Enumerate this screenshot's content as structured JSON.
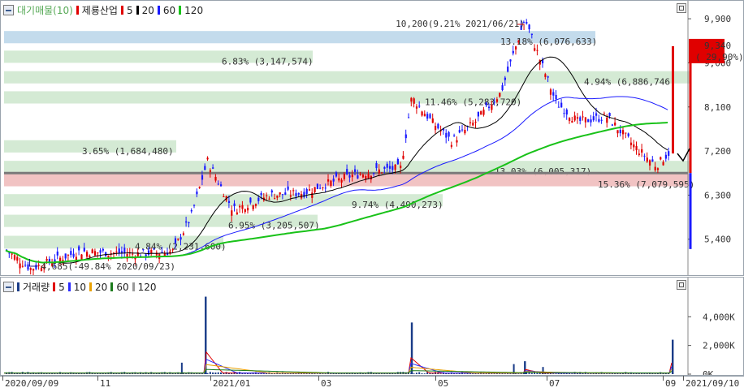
{
  "price_legend": {
    "title": "대기매물(10)",
    "stock_name": "제룡산업",
    "ma_labels": [
      "5",
      "20",
      "60",
      "120"
    ],
    "colors": {
      "stock": "#e00000",
      "ma5": "#e00000",
      "ma20": "#000000",
      "ma60": "#1a1aff",
      "ma120": "#19c219"
    }
  },
  "volume_legend": {
    "title": "거래량",
    "ma_labels": [
      "5",
      "10",
      "20",
      "60",
      "120"
    ],
    "colors": {
      "volume": "#1a3c88",
      "ma5": "#e00000",
      "ma10": "#2b2bff",
      "ma20": "#e8a000",
      "ma60": "#1a7a1a",
      "ma120": "#999999"
    }
  },
  "price_axis": [
    "9,900",
    "9,000",
    "8,100",
    "7,200",
    "6,300",
    "5,400"
  ],
  "current_price": {
    "value": "9,340",
    "change": "( 29,90%)"
  },
  "volume_axis": [
    "4,000K",
    "2,000K",
    "0K"
  ],
  "date_axis": [
    "2020/09/09",
    "11",
    "2021/01",
    "03",
    "05",
    "07",
    "09",
    "2021/09/10"
  ],
  "annotations": {
    "high": "10,200(9.21% 2021/06/21)",
    "low": "4,685(-49.84% 2020/09/23)"
  },
  "supply_bands": [
    {
      "label": "13.18% (6,076,633)",
      "color": "#bcd7ea"
    },
    {
      "label": "6.83% (3,147,574)",
      "color": "#cfe8cf"
    },
    {
      "label": "4.94% (6,886,746)",
      "color": "#cfe8cf"
    },
    {
      "label": "11.46% (5,283,720)",
      "color": "#cfe8cf"
    },
    {
      "label": "3.65% (1,684,480)",
      "color": "#cfe8cf"
    },
    {
      "label": "13.03% (6,005,317)",
      "color": "#cfe8cf"
    },
    {
      "label": "15.36% (7,079,595)",
      "color": "#efbcbc"
    },
    {
      "label": "9.74% (4,490,273)",
      "color": "#cfe8cf"
    },
    {
      "label": "6.95% (3,205,507)",
      "color": "#cfe8cf"
    },
    {
      "label": "4.84% (2,231,600)",
      "color": "#cfe8cf"
    }
  ],
  "chart_data": {
    "type": "candlestick",
    "title": "제룡산업",
    "x_range": [
      "2020/09/09",
      "2021/09/10"
    ],
    "ylim": [
      4700,
      10200
    ],
    "y_ticks": [
      9900,
      9000,
      8100,
      7200,
      6300,
      5400
    ],
    "last_price": 9340,
    "last_change_pct": 29.9,
    "period_high": {
      "value": 10200,
      "pct": 9.21,
      "date": "2021/06/21"
    },
    "period_low": {
      "value": 4685,
      "pct": -49.84,
      "date": "2020/09/23"
    },
    "close_anchors": [
      {
        "date": "2020/09/09",
        "close": 5200
      },
      {
        "date": "2020/09/23",
        "close": 4800
      },
      {
        "date": "2020/10/20",
        "close": 5150
      },
      {
        "date": "2020/11/20",
        "close": 5100
      },
      {
        "date": "2020/12/10",
        "close": 5150
      },
      {
        "date": "2020/12/20",
        "close": 5850
      },
      {
        "date": "2020/12/29",
        "close": 7000
      },
      {
        "date": "2021/01/12",
        "close": 6000
      },
      {
        "date": "2021/02/01",
        "close": 6300
      },
      {
        "date": "2021/02/20",
        "close": 6350
      },
      {
        "date": "2021/03/02",
        "close": 6500
      },
      {
        "date": "2021/03/18",
        "close": 6700
      },
      {
        "date": "2021/04/02",
        "close": 6800
      },
      {
        "date": "2021/04/14",
        "close": 6850
      },
      {
        "date": "2021/04/20",
        "close": 8300
      },
      {
        "date": "2021/05/01",
        "close": 7800
      },
      {
        "date": "2021/05/12",
        "close": 7400
      },
      {
        "date": "2021/05/25",
        "close": 7800
      },
      {
        "date": "2021/06/08",
        "close": 8400
      },
      {
        "date": "2021/06/21",
        "close": 9900
      },
      {
        "date": "2021/06/30",
        "close": 9000
      },
      {
        "date": "2021/07/08",
        "close": 8200
      },
      {
        "date": "2021/07/20",
        "close": 7800
      },
      {
        "date": "2021/08/05",
        "close": 7900
      },
      {
        "date": "2021/08/20",
        "close": 7300
      },
      {
        "date": "2021/09/01",
        "close": 6900
      },
      {
        "date": "2021/09/09",
        "close": 7200
      },
      {
        "date": "2021/09/10",
        "close": 9340
      }
    ],
    "volume_spikes": [
      {
        "date": "2020/12/28",
        "volume_k": 5400
      },
      {
        "date": "2021/04/20",
        "volume_k": 3600
      },
      {
        "date": "2021/06/21",
        "volume_k": 900
      },
      {
        "date": "2021/09/10",
        "volume_k": 2400
      }
    ]
  }
}
